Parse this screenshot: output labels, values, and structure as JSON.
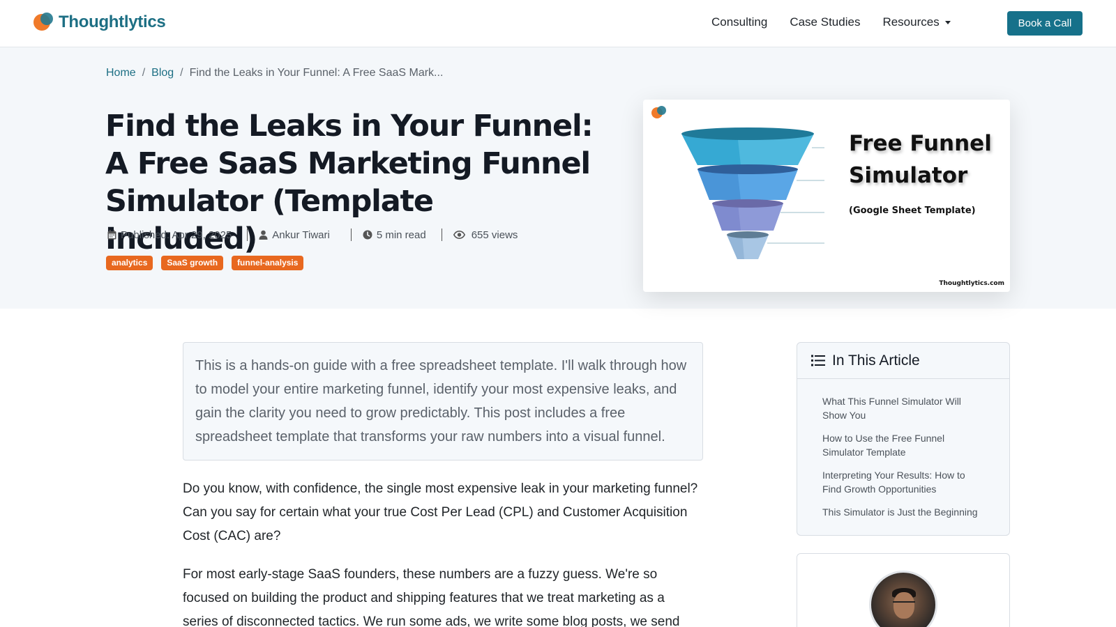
{
  "nav": {
    "brand": "Thoughtlytics",
    "links": [
      "Consulting",
      "Case Studies",
      "Resources"
    ],
    "cta": "Book a Call"
  },
  "breadcrumb": {
    "home": "Home",
    "blog": "Blog",
    "current": "Find the Leaks in Your Funnel: A Free SaaS Mark..."
  },
  "article": {
    "title": "Find the Leaks in Your Funnel: A Free SaaS Marketing Funnel Simulator (Template Included)",
    "published": "Published: Apr 29, 2025",
    "author": "Ankur Tiwari",
    "read_time": "5 min read",
    "views": "655 views",
    "tags": [
      "analytics",
      "SaaS growth",
      "funnel-analysis"
    ],
    "lead": "This is a hands-on guide with a free spreadsheet template. I'll walk through how to model your entire marketing funnel, identify your most expensive leaks, and gain the clarity you need to grow predictably. This post includes a free spreadsheet template that transforms your raw numbers into a visual funnel.",
    "p1": "Do you know, with confidence, the single most expensive leak in your marketing funnel? Can you say for certain what your true Cost Per Lead (CPL) and Customer Acquisition Cost (CAC) are?",
    "p2": "For most early-stage SaaS founders, these numbers are a fuzzy guess. We're so focused on building the product and shipping features that we treat marketing as a series of disconnected tactics. We run some ads, we write some blog posts, we send"
  },
  "feature_image": {
    "title": "Free Funnel Simulator",
    "subtitle": "(Google Sheet Template)",
    "site": "Thoughtlytics.com",
    "funnel_colors": [
      "#4fb9de",
      "#5aa6e6",
      "#8e9ad8",
      "#a8c6e4"
    ]
  },
  "toc": {
    "heading": "In This Article",
    "items": [
      "What This Funnel Simulator Will Show You",
      "How to Use the Free Funnel Simulator Template",
      "Interpreting Your Results: How to Find Growth Opportunities",
      "This Simulator is Just the Beginning"
    ]
  },
  "colors": {
    "brand": "#1d6f84",
    "accent": "#16718a",
    "tag": "#e8681f",
    "hero_bg": "#f4f7fa"
  }
}
